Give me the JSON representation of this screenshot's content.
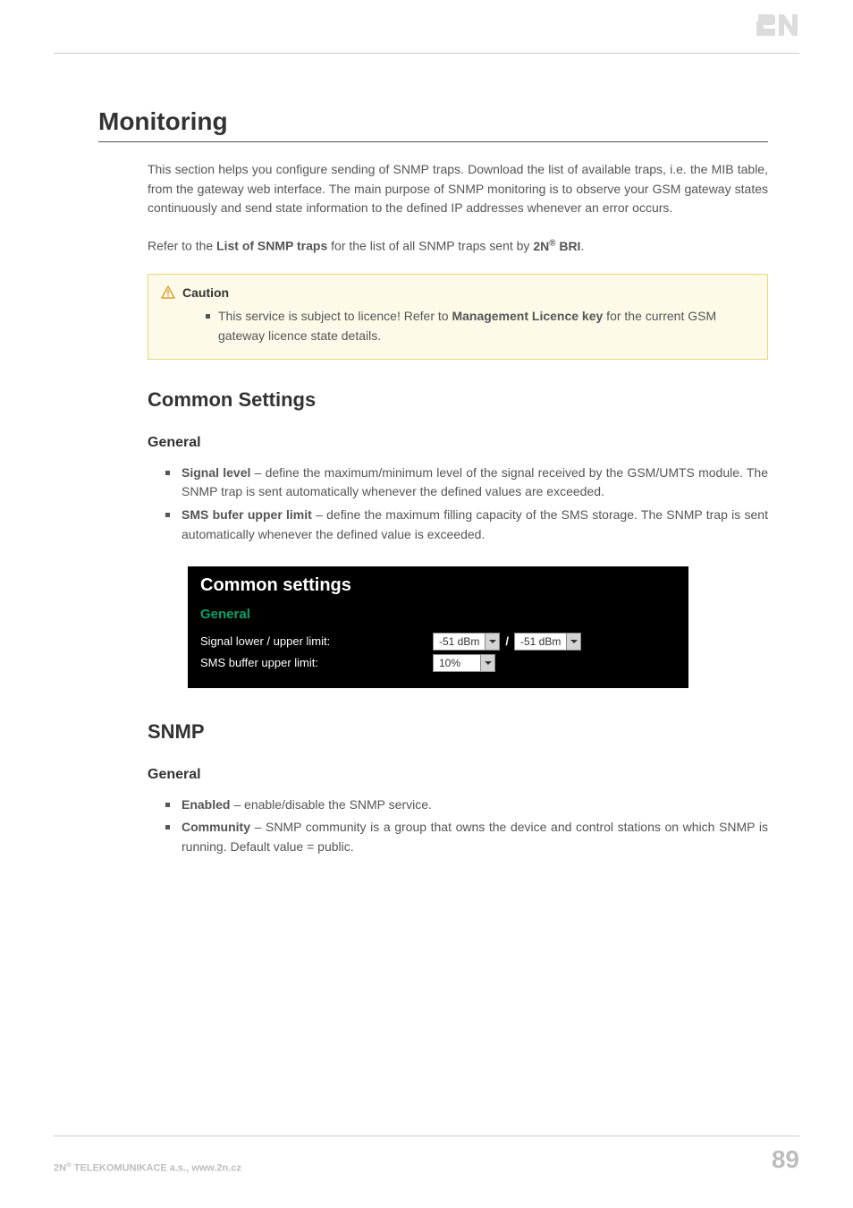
{
  "logo": {
    "brand": "2N"
  },
  "page": {
    "title": "Monitoring",
    "intro_p1": "This section helps you configure sending of SNMP traps. Download the list of available traps, i.e. the MIB table, from the gateway web interface. The main purpose of SNMP monitoring is to observe your GSM gateway states continuously and send state information to the defined IP addresses whenever an error occurs.",
    "refer_prefix": "Refer to the ",
    "refer_bold": "List of SNMP traps",
    "refer_mid": " for the list of all SNMP traps sent by ",
    "refer_product_prefix": "2N",
    "refer_product_sup": "®",
    "refer_product_suffix": " BRI",
    "refer_end": "."
  },
  "caution": {
    "title": "Caution",
    "text_prefix": "This service is subject to licence! Refer to ",
    "text_bold": "Management  Licence key",
    "text_suffix": " for the current GSM gateway licence state details."
  },
  "common_settings": {
    "heading": "Common Settings",
    "general_heading": "General",
    "items": [
      {
        "term": "Signal level",
        "desc": " – define the maximum/minimum level of the signal received by the GSM/UMTS module. The SNMP trap is sent automatically whenever the defined values are exceeded."
      },
      {
        "term": "SMS bufer upper limit",
        "desc": " – define the maximum filling capacity of the SMS storage. The SNMP trap is sent automatically whenever the defined value is exceeded."
      }
    ]
  },
  "screenshot": {
    "panel_title": "Common settings",
    "section_label": "General",
    "rows": {
      "signal": {
        "label": "Signal lower / upper limit:",
        "lower": "-51 dBm",
        "upper": "-51 dBm",
        "separator": "/"
      },
      "sms": {
        "label": "SMS buffer upper limit:",
        "value": "10%"
      }
    }
  },
  "snmp": {
    "heading": "SNMP",
    "general_heading": "General",
    "items": [
      {
        "term": "Enabled",
        "desc": " – enable/disable the SNMP service."
      },
      {
        "term": "Community",
        "desc": " –  SNMP community is a group that owns the device and control stations on which SNMP is running. Default value = public."
      }
    ]
  },
  "footer": {
    "company_prefix": "2N",
    "company_sup": "®",
    "company_suffix": " TELEKOMUNIKACE a.s., www.2n.cz",
    "page_number": "89"
  }
}
